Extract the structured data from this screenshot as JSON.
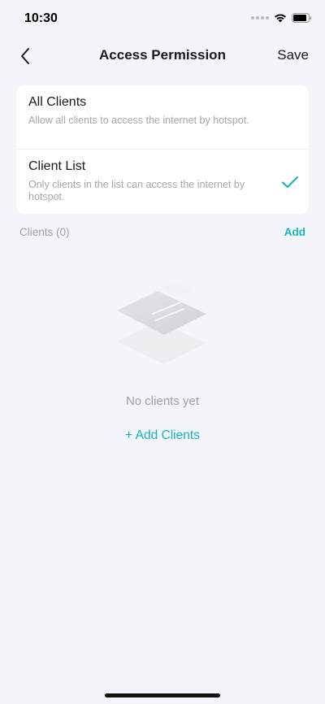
{
  "status_bar": {
    "time": "10:30",
    "icons": [
      "cellular-dots-icon",
      "wifi-icon",
      "battery-icon"
    ]
  },
  "nav": {
    "back_icon": "chevron-left-icon",
    "title": "Access Permission",
    "save_label": "Save"
  },
  "options": [
    {
      "title": "All Clients",
      "description": "Allow all clients to access the internet by hotspot.",
      "selected": false
    },
    {
      "title": "Client List",
      "description": "Only clients in the list can access the internet by hotspot.",
      "selected": true
    }
  ],
  "clients_section": {
    "label": "Clients (0)",
    "add_label": "Add"
  },
  "empty_state": {
    "illustration": "empty-list-illustration",
    "message": "No clients yet",
    "add_button_label": "+ Add Clients"
  },
  "colors": {
    "accent": "#19b3bd",
    "background": "#f4f5fa",
    "card": "#ffffff",
    "muted_text": "#9ea0a7"
  }
}
